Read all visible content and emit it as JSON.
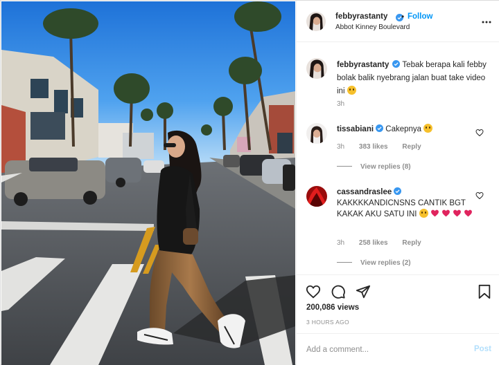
{
  "header": {
    "username": "febbyrastanty",
    "separator": "•",
    "follow_label": "Follow",
    "location": "Abbot Kinney Boulevard"
  },
  "caption": {
    "username": "febbyrastanty",
    "text": "Tebak berapa kali febby bolak balik nyebrang jalan buat take video ini",
    "emoji": "thinking-face-emoji",
    "time": "3h"
  },
  "comments": [
    {
      "username": "tissabiani",
      "text": "Cakepnya",
      "emoji": "heart-eyes-emoji",
      "time": "3h",
      "likes": "383 likes",
      "reply_label": "Reply",
      "replies_label": "View replies (8)"
    },
    {
      "username": "cassandraslee",
      "text": "KAKKKKANDICNSNS CANTIK BGT KAKAK AKU SATU INI",
      "emoji": "pleading-face-emoji, red-hearts",
      "time": "3h",
      "likes": "258 likes",
      "reply_label": "Reply",
      "replies_label": "View replies (2)"
    }
  ],
  "actions": {
    "icons": [
      "heart-icon",
      "comment-icon",
      "share-icon",
      "bookmark-icon"
    ],
    "views": "200,086 views",
    "time_ago": "3 HOURS AGO"
  },
  "add_comment": {
    "placeholder": "Add a comment...",
    "post_label": "Post"
  },
  "colors": {
    "link_blue": "#0095f6",
    "post_disabled": "#b2dffc",
    "verified_blue": "#3897f0",
    "text": "#262626",
    "muted": "#8e8e8e",
    "heart_red": "#ed4956"
  }
}
